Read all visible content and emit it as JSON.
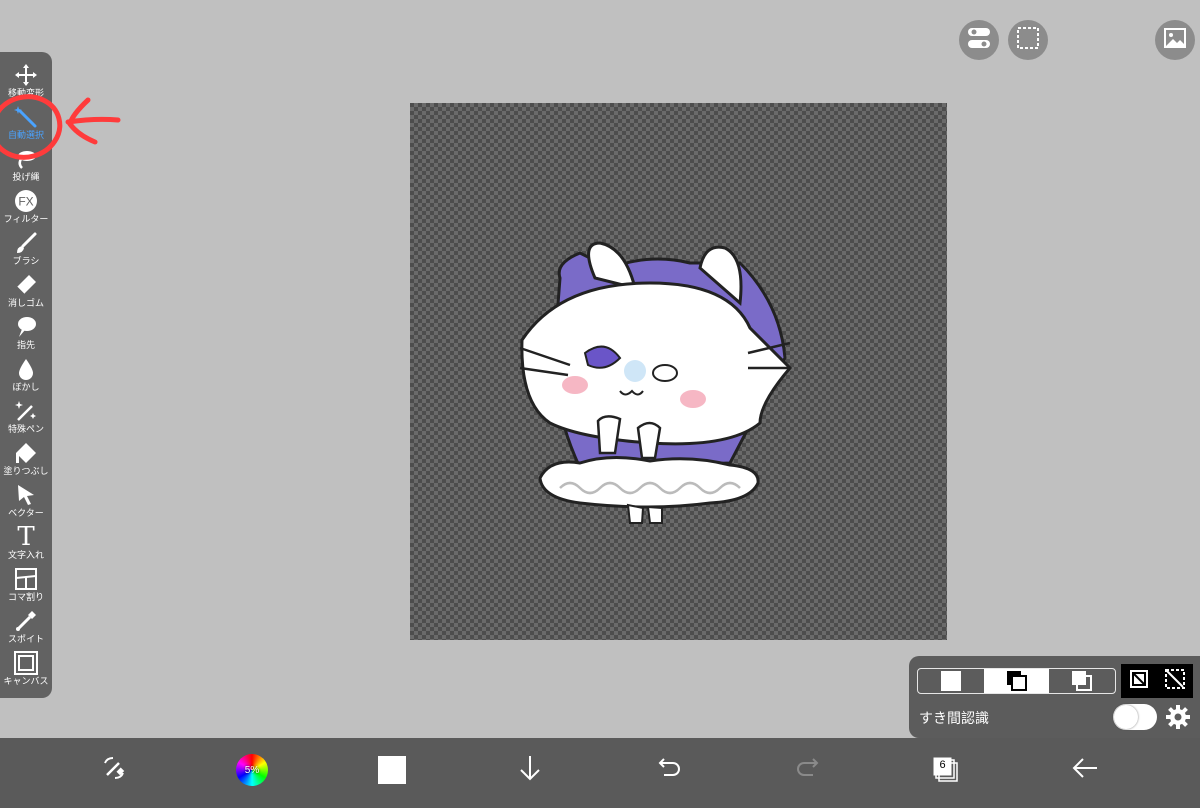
{
  "toolbar": {
    "tools": [
      {
        "id": "move",
        "label": "移動変形",
        "icon": "move-icon",
        "active": false
      },
      {
        "id": "auto-select",
        "label": "自動選択",
        "icon": "magic-wand-icon",
        "active": true
      },
      {
        "id": "lasso",
        "label": "投げ縄",
        "icon": "lasso-icon",
        "active": false
      },
      {
        "id": "filter",
        "label": "フィルター",
        "icon": "fx-icon",
        "active": false
      },
      {
        "id": "brush",
        "label": "ブラシ",
        "icon": "brush-icon",
        "active": false
      },
      {
        "id": "eraser",
        "label": "消しゴム",
        "icon": "eraser-icon",
        "active": false
      },
      {
        "id": "smudge",
        "label": "指先",
        "icon": "finger-icon",
        "active": false
      },
      {
        "id": "blur",
        "label": "ぼかし",
        "icon": "drop-icon",
        "active": false
      },
      {
        "id": "special-pen",
        "label": "特殊ペン",
        "icon": "sparkle-pen-icon",
        "active": false
      },
      {
        "id": "fill",
        "label": "塗りつぶし",
        "icon": "bucket-icon",
        "active": false
      },
      {
        "id": "vector",
        "label": "ベクター",
        "icon": "cursor-arrow-icon",
        "active": false
      },
      {
        "id": "text",
        "label": "文字入れ",
        "icon": "text-icon",
        "active": false
      },
      {
        "id": "frame",
        "label": "コマ割り",
        "icon": "panel-icon",
        "active": false
      },
      {
        "id": "eyedropper",
        "label": "スポイト",
        "icon": "eyedropper-icon",
        "active": false
      },
      {
        "id": "canvas",
        "label": "キャンバス",
        "icon": "canvas-icon",
        "active": false
      }
    ],
    "fx_text": "FX",
    "text_glyph": "T"
  },
  "top_buttons": [
    {
      "id": "toggle-panel",
      "icon": "toggle-switches-icon"
    },
    {
      "id": "selection",
      "icon": "dashed-selection-icon"
    },
    {
      "id": "gallery",
      "icon": "gallery-icon"
    }
  ],
  "selection_panel": {
    "gap_detection_label": "すき間認識",
    "gap_detection_on": false,
    "reference_mode": "layer"
  },
  "bottom_bar": {
    "color_wheel_label": "5%",
    "layer_count": "6",
    "current_color": "#ffffff"
  },
  "colors": {
    "accent": "#4aa3ff",
    "annotation": "#ff3b3b",
    "bunny_purple": "#7a6bc8"
  }
}
